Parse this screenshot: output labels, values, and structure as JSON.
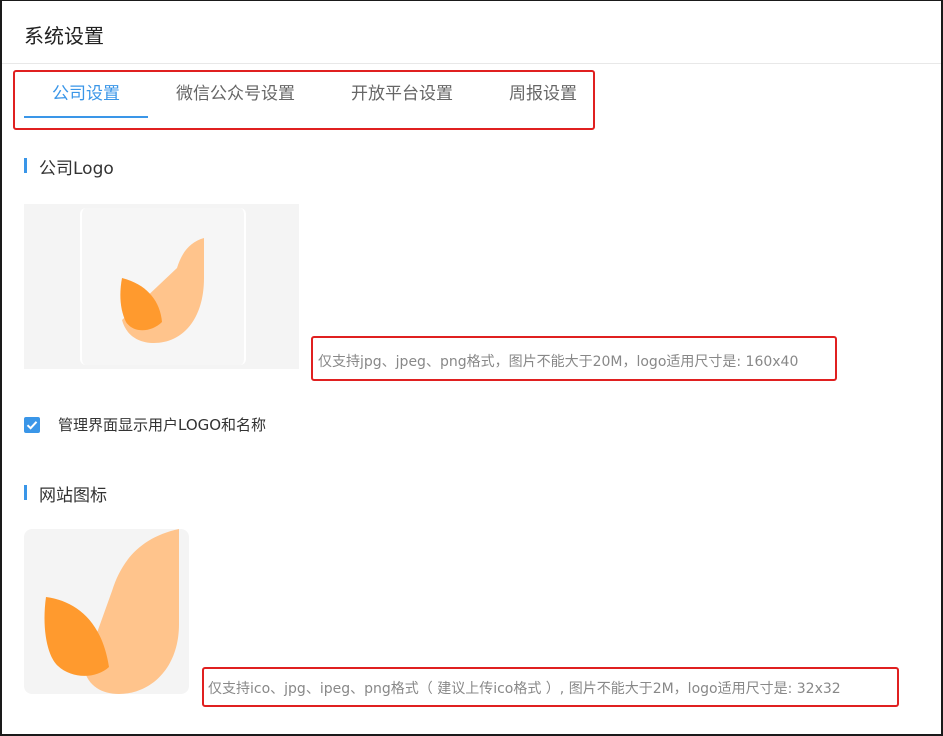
{
  "page": {
    "title": "系统设置"
  },
  "tabs": [
    {
      "label": "公司设置",
      "active": true
    },
    {
      "label": "微信公众号设置",
      "active": false
    },
    {
      "label": "开放平台设置",
      "active": false
    },
    {
      "label": "周报设置",
      "active": false
    }
  ],
  "company_logo": {
    "section_title": "公司Logo",
    "hint": "仅支持jpg、jpeg、png格式，图片不能大于20M，logo适用尺寸是: 160x40"
  },
  "display_option": {
    "checked": true,
    "label": "管理界面显示用户LOGO和名称"
  },
  "site_icon": {
    "section_title": "网站图标",
    "hint": "仅支持ico、jpg、ipeg、png格式（ 建议上传ico格式 ）, 图片不能大于2M，logo适用尺寸是: 32x32"
  },
  "colors": {
    "accent": "#3a96e8",
    "highlight_border": "#e02020",
    "logo_light": "#ffc48c",
    "logo_dark": "#ff9a2e"
  }
}
